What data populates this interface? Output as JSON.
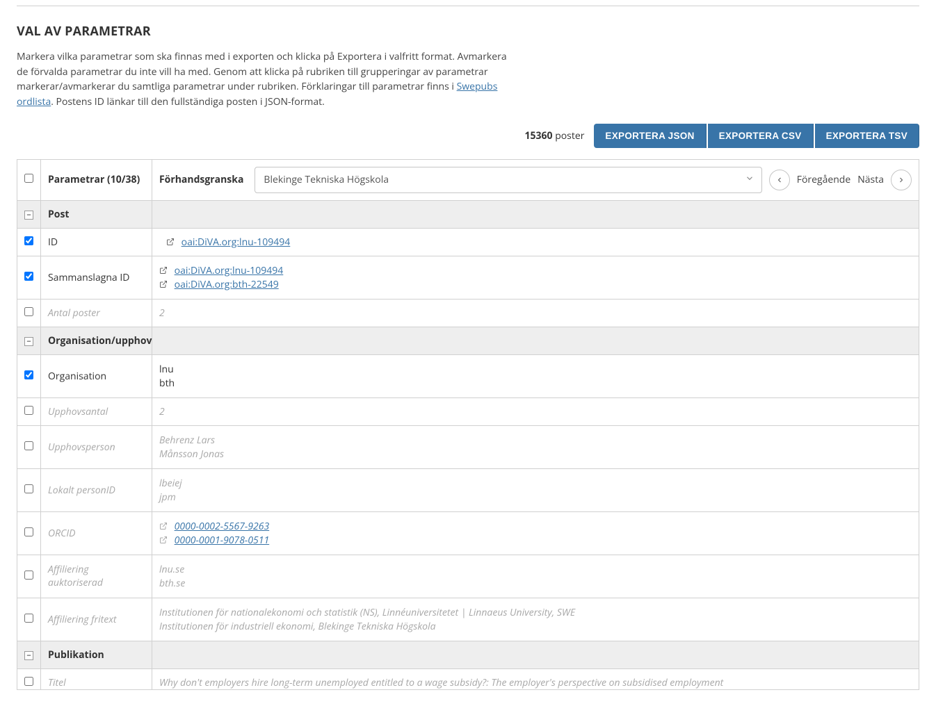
{
  "section_title": "VAL AV PARAMETRAR",
  "intro": {
    "text_before_link": "Markera vilka parametrar som ska finnas med i exporten och klicka på Exportera i valfritt format. Avmarkera de förvalda parametrar du inte vill ha med. Genom att klicka på rubriken till grupperingar av parametrar markerar/avmarkerar du samtliga parametrar under rubriken. Förklaringar till parametrar finns i ",
    "link_text": "Swepubs ordlista",
    "text_after_link": ". Postens ID länkar till den fullständiga posten i JSON-format."
  },
  "post_count": {
    "number": "15360",
    "word": "poster"
  },
  "export_buttons": {
    "json": "EXPORTERA JSON",
    "csv": "EXPORTERA CSV",
    "tsv": "EXPORTERA TSV"
  },
  "headers": {
    "parametrar": "Parametrar (10/38)",
    "forhandsgranska": "Förhandsgranska",
    "select_value": "Blekinge Tekniska Högskola",
    "prev": "Föregående",
    "next": "Nästa"
  },
  "groups": {
    "post": "Post",
    "org": "Organisation/upphov",
    "pub": "Publikation"
  },
  "rows": {
    "id": {
      "label": "ID",
      "link": "oai:DiVA.org:lnu-109494"
    },
    "sammanslagna": {
      "label": "Sammanslagna ID",
      "link1": "oai:DiVA.org:lnu-109494",
      "link2": "oai:DiVA.org:bth-22549"
    },
    "antal_poster": {
      "label": "Antal poster",
      "value": "2"
    },
    "organisation": {
      "label": "Organisation",
      "v1": "lnu",
      "v2": "bth"
    },
    "upphovsantal": {
      "label": "Upphovsantal",
      "value": "2"
    },
    "upphovsperson": {
      "label": "Upphovsperson",
      "v1": "Behrenz Lars",
      "v2": "Månsson Jonas"
    },
    "lokalt_personid": {
      "label": "Lokalt personID",
      "v1": "lbeiej",
      "v2": "jpm"
    },
    "orcid": {
      "label": "ORCID",
      "v1": "0000-0002-5567-9263",
      "v2": "0000-0001-9078-0511"
    },
    "aff_aukt": {
      "label": "Affiliering auktoriserad",
      "v1": "lnu.se",
      "v2": "bth.se"
    },
    "aff_fritext": {
      "label": "Affiliering fritext",
      "v1": "Institutionen för nationalekonomi och statistik (NS), Linnéuniversitetet | Linnaeus University, SWE",
      "v2": "Institutionen för industriell ekonomi, Blekinge Tekniska Högskola"
    },
    "titel": {
      "label": "Titel",
      "value": "Why don't employers hire long-term unemployed entitled to a wage subsidy?: The employer's perspective on subsidised employment"
    }
  }
}
